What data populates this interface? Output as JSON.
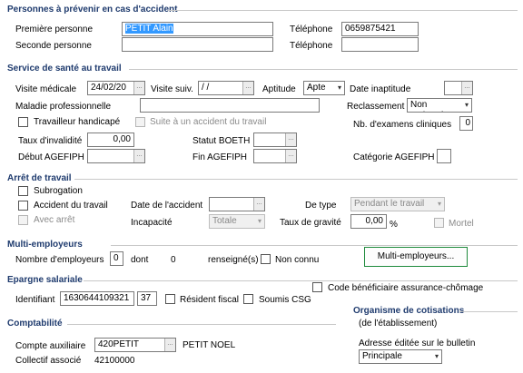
{
  "sections": {
    "personnes": "Personnes à prévenir en cas d'accident",
    "sante": "Service de santé au travail",
    "arret": "Arrêt de travail",
    "multi": "Multi-employeurs",
    "epargne": "Epargne salariale",
    "compta": "Comptabilité",
    "organisme": "Organisme de cotisations",
    "organisme_sub": "(de l'établissement)"
  },
  "personnes": {
    "premiere_label": "Première personne",
    "premiere_value": "PETIT Alain",
    "seconde_label": "Seconde personne",
    "seconde_value": "",
    "tel1_label": "Téléphone",
    "tel1_value": "0659875421",
    "tel2_label": "Téléphone",
    "tel2_value": ""
  },
  "sante": {
    "visite_medicale_label": "Visite médicale",
    "visite_medicale_value": "24/02/20",
    "visite_suiv_label": "Visite suiv.",
    "visite_suiv_value": " / /",
    "aptitude_label": "Aptitude",
    "aptitude_value": "Apte",
    "date_inaptitude_label": "Date inaptitude",
    "date_inaptitude_value": "",
    "maladie_label": "Maladie professionnelle",
    "maladie_value": "",
    "reclassement_label": "Reclassement",
    "reclassement_value": "Non reclassé",
    "travailleur_handicape_label": "Travailleur handicapé",
    "suite_accident_label": "Suite à un accident du travail",
    "nb_examens_label": "Nb. d'examens cliniques",
    "nb_examens_value": "0",
    "taux_invalidite_label": "Taux d'invalidité",
    "taux_invalidite_value": "0,00",
    "statut_boeth_label": "Statut BOETH",
    "statut_boeth_value": "",
    "debut_agefiph_label": "Début AGEFIPH",
    "debut_agefiph_value": "",
    "fin_agefiph_label": "Fin AGEFIPH",
    "fin_agefiph_value": "",
    "categorie_agefiph_label": "Catégorie AGEFIPH",
    "categorie_agefiph_value": ""
  },
  "arret": {
    "subrogation_label": "Subrogation",
    "accident_label": "Accident du travail",
    "avec_arret_label": "Avec arrêt",
    "date_accident_label": "Date de l'accident",
    "date_accident_value": "",
    "de_type_label": "De type",
    "de_type_value": "Pendant le travail",
    "incapacite_label": "Incapacité",
    "incapacite_value": "Totale",
    "taux_gravite_label": "Taux de gravité",
    "taux_gravite_value": "0,00",
    "percent": "%",
    "mortel_label": "Mortel"
  },
  "multi": {
    "nb_label": "Nombre d'employeurs",
    "nb_value": "0",
    "dont_label": "dont",
    "dont_value": "0",
    "renseignes_label": "renseigné(s)",
    "non_connu_label": "Non connu",
    "button_label": "Multi-employeurs..."
  },
  "epargne": {
    "code_label": "Code bénéficiaire assurance-chômage",
    "identifiant_label": "Identifiant",
    "identifiant_value": "1630644109321",
    "identifiant_key": "37",
    "resident_label": "Résident fiscal",
    "soumis_label": "Soumis CSG"
  },
  "compta": {
    "compte_label": "Compte auxiliaire",
    "compte_value": "420PETIT",
    "compte_name": "PETIT NOEL",
    "collectif_label": "Collectif associé",
    "collectif_value": "42100000"
  },
  "organisme": {
    "adresse_label": "Adresse éditée sur le bulletin",
    "adresse_value": "Principale"
  },
  "icons": {
    "ellipsis": "…",
    "dropdown": "▾"
  },
  "colors": {
    "section_title": "#1f3b6e",
    "selection": "#3399ff",
    "button_border": "#1e8a3c"
  }
}
